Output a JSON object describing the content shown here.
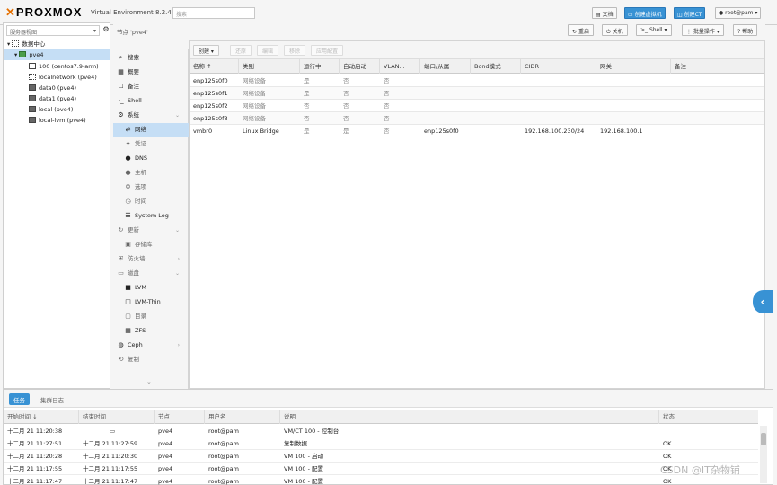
{
  "header": {
    "logo": "PROXMOX",
    "version": "Virtual Environment 8.2.4",
    "search_placeholder": "搜索",
    "docs_button": "文档",
    "create_vm_button": "创建虚拟机",
    "create_ct_button": "创建CT",
    "user_button": "root@pam"
  },
  "tree": {
    "view_select": "服务器视图",
    "items": [
      {
        "label": "数据中心"
      },
      {
        "label": "pve4"
      },
      {
        "label": "100 (centos7.9-arm)"
      },
      {
        "label": "localnetwork (pve4)"
      },
      {
        "label": "data0 (pve4)"
      },
      {
        "label": "data1 (pve4)"
      },
      {
        "label": "local (pve4)"
      },
      {
        "label": "local-lvm (pve4)"
      }
    ]
  },
  "node": {
    "title": "节点 'pve4'",
    "reboot_button": "重启",
    "shutdown_button": "关机",
    "shell_button": "Shell",
    "bulk_button": "批量操作",
    "help_button": "帮助"
  },
  "menu": {
    "items": [
      {
        "label": "搜索",
        "icon": "search-icon"
      },
      {
        "label": "概要",
        "icon": "summary-icon"
      },
      {
        "label": "备注",
        "icon": "notes-icon"
      },
      {
        "label": "Shell",
        "icon": "terminal-icon"
      },
      {
        "label": "系统",
        "icon": "gear-icon"
      },
      {
        "label": "网络",
        "icon": "network-icon"
      },
      {
        "label": "凭证",
        "icon": "certificate-icon"
      },
      {
        "label": "DNS",
        "icon": "globe-icon"
      },
      {
        "label": "主机",
        "icon": "globe-icon"
      },
      {
        "label": "选项",
        "icon": "options-icon"
      },
      {
        "label": "时间",
        "icon": "clock-icon"
      },
      {
        "label": "System Log",
        "icon": "list-icon"
      },
      {
        "label": "更新",
        "icon": "refresh-icon"
      },
      {
        "label": "存储库",
        "icon": "repository-icon"
      },
      {
        "label": "防火墙",
        "icon": "shield-icon"
      },
      {
        "label": "磁盘",
        "icon": "disk-icon"
      },
      {
        "label": "LVM",
        "icon": "square-icon"
      },
      {
        "label": "LVM-Thin",
        "icon": "square-outline-icon"
      },
      {
        "label": "目录",
        "icon": "folder-icon"
      },
      {
        "label": "ZFS",
        "icon": "grid-icon"
      },
      {
        "label": "Ceph",
        "icon": "ceph-icon"
      },
      {
        "label": "复制",
        "icon": "replication-icon"
      }
    ]
  },
  "network": {
    "toolbar": {
      "create": "创建",
      "revert": "还原",
      "edit": "编辑",
      "remove": "移除",
      "apply": "应用配置"
    },
    "columns": [
      "名称 ↑",
      "类别",
      "运行中",
      "自动启动",
      "VLAN...",
      "端口/从属",
      "Bond模式",
      "CIDR",
      "网关",
      "备注"
    ],
    "rows": [
      [
        "enp125s0f0",
        "网络设备",
        "是",
        "否",
        "否",
        "",
        "",
        "",
        "",
        ""
      ],
      [
        "enp125s0f1",
        "网络设备",
        "是",
        "否",
        "否",
        "",
        "",
        "",
        "",
        ""
      ],
      [
        "enp125s0f2",
        "网络设备",
        "否",
        "否",
        "否",
        "",
        "",
        "",
        "",
        ""
      ],
      [
        "enp125s0f3",
        "网络设备",
        "否",
        "否",
        "否",
        "",
        "",
        "",
        "",
        ""
      ],
      [
        "vmbr0",
        "Linux Bridge",
        "是",
        "是",
        "否",
        "enp125s0f0",
        "",
        "192.168.100.230/24",
        "192.168.100.1",
        ""
      ]
    ]
  },
  "log": {
    "tab_tasks": "任务",
    "tab_cluster": "集群日志",
    "columns": [
      "开始时间 ↓",
      "结束时间",
      "节点",
      "用户名",
      "说明",
      "状态"
    ],
    "rows": [
      [
        "十二月 21 11:20:38",
        "",
        "pve4",
        "root@pam",
        "VM/CT 100 - 控制台",
        ""
      ],
      [
        "十二月 21 11:27:51",
        "十二月 21 11:27:59",
        "pve4",
        "root@pam",
        "复制数据",
        "OK"
      ],
      [
        "十二月 21 11:20:28",
        "十二月 21 11:20:30",
        "pve4",
        "root@pam",
        "VM 100 - 启动",
        "OK"
      ],
      [
        "十二月 21 11:17:55",
        "十二月 21 11:17:55",
        "pve4",
        "root@pam",
        "VM 100 - 配置",
        "OK"
      ],
      [
        "十二月 21 11:17:47",
        "十二月 21 11:17:47",
        "pve4",
        "root@pam",
        "VM 100 - 配置",
        "OK"
      ]
    ]
  },
  "watermark": "CSDN @IT杂物铺"
}
